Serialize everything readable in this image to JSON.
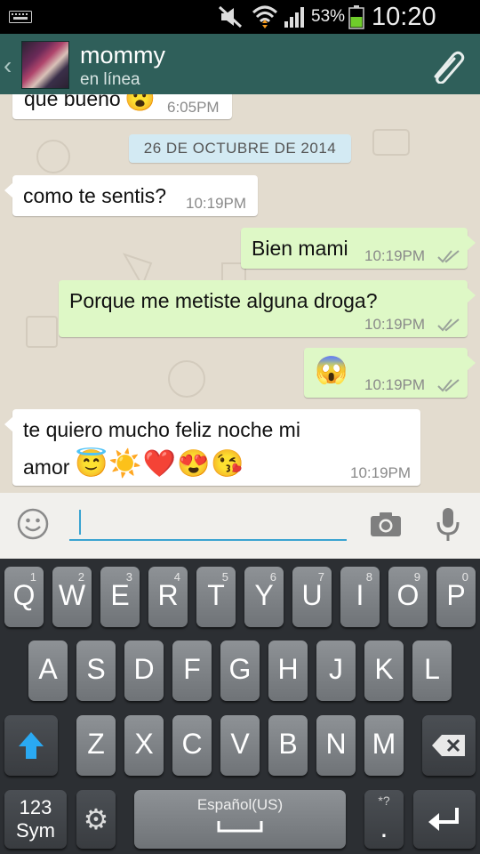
{
  "status_bar": {
    "battery_pct": "53%",
    "time": "10:20 PM"
  },
  "contact": {
    "name": "mommy",
    "status": "en línea"
  },
  "messages": [
    {
      "text": "que bueno",
      "time": "6:05PM"
    },
    {
      "date": "26 DE OCTUBRE DE 2014"
    },
    {
      "text": "como te sentis?",
      "time": "10:19PM"
    },
    {
      "text": "Bien mami",
      "time": "10:19PM"
    },
    {
      "text": "Porque me metiste alguna droga?",
      "time": "10:19PM"
    },
    {
      "text": "😱",
      "time": "10:19PM"
    },
    {
      "line1": "te quiero mucho feliz noche mi",
      "line2": "amor",
      "emoji": "😇☀️❤️😍😘",
      "time": "10:19PM"
    }
  ],
  "keyboard": {
    "row1": [
      [
        "Q",
        "1"
      ],
      [
        "W",
        "2"
      ],
      [
        "E",
        "3"
      ],
      [
        "R",
        "4"
      ],
      [
        "T",
        "5"
      ],
      [
        "Y",
        "6"
      ],
      [
        "U",
        "7"
      ],
      [
        "I",
        "8"
      ],
      [
        "O",
        "9"
      ],
      [
        "P",
        "0"
      ]
    ],
    "row2": [
      "A",
      "S",
      "D",
      "F",
      "G",
      "H",
      "J",
      "K",
      "L"
    ],
    "row3": [
      "Z",
      "X",
      "C",
      "V",
      "B",
      "N",
      "M"
    ],
    "sym_top": "123",
    "sym_bottom": "Sym",
    "space_label": "Español(US)",
    "period_hint": "*?",
    "period": "."
  },
  "colors": {
    "header": "#2f5f5a",
    "outgoing": "#def8c6",
    "incoming": "#ffffff",
    "accent": "#3aa3d1",
    "chat_bg": "#e3dccf"
  },
  "icons": [
    "keyboard-icon",
    "mute-icon",
    "wifi-icon",
    "signal-icon",
    "battery-icon",
    "back-icon",
    "avatar",
    "attach-icon",
    "tick-icon",
    "smiley-icon",
    "camera-icon",
    "mic-icon",
    "shift-icon",
    "settings-icon",
    "backspace-icon",
    "enter-icon"
  ]
}
